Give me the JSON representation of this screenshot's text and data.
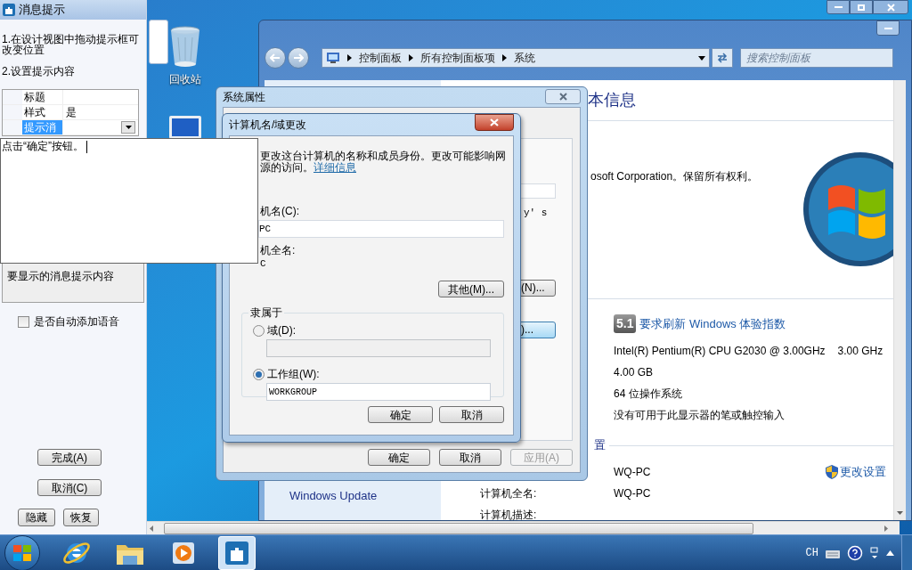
{
  "message_window": {
    "title": "消息提示",
    "steps": [
      "1.在设计视图中拖动提示框可改变位置",
      "2.设置提示内容"
    ],
    "properties": [
      {
        "name": "标题",
        "selected": false
      },
      {
        "name": "样式",
        "value": "是",
        "selected": false
      },
      {
        "name": "提示消",
        "selected": true
      }
    ],
    "editor": {
      "value": "点击“确定”按钮。"
    },
    "description": "要显示的消息提示内容",
    "voice_option": {
      "label": "是否自动添加语音",
      "checked": false
    },
    "buttons": [
      "完成(A)",
      "取消(C)",
      "隐藏",
      "恢复"
    ]
  },
  "desktop": {
    "icons": [
      {
        "kind": "recycle-bin",
        "label": "回收站"
      },
      {
        "kind": "computer"
      }
    ]
  },
  "control_panel": {
    "breadcrumb": [
      "控制面板",
      "所有控制面板项",
      "系统"
    ],
    "search": {
      "placeholder": "搜索控制面板"
    },
    "heading": "本信息",
    "copyright": "osoft Corporation。保留所有权利。",
    "rating": {
      "score": "5.1",
      "link": "要求刷新 Windows 体验指数"
    },
    "specs": [
      {
        "label": "Intel(R) Pentium(R) CPU G2030 @ 3.00GHz",
        "value": "3.00 GHz"
      },
      {
        "label": "4.00 GB"
      },
      {
        "label": "64 位操作系统"
      },
      {
        "label": "没有可用于此显示器的笔或触控输入"
      }
    ],
    "section": "置",
    "computer_name": "WQ-PC",
    "change_link": "更改设置",
    "rows": [
      {
        "label": "计算机全名:",
        "value": "WQ-PC"
      },
      {
        "label": "计算机描述:"
      }
    ],
    "nav": [
      "Windows Update"
    ]
  },
  "system_properties": {
    "title": "系统属性",
    "fragment": "y' s",
    "side_buttons": [
      {
        "label": "(N)...",
        "focused": false
      },
      {
        "label": ")...",
        "focused": true
      }
    ],
    "buttons": [
      {
        "label": "确定",
        "disabled": false
      },
      {
        "label": "取消",
        "disabled": false
      },
      {
        "label": "应用(A)",
        "disabled": true
      }
    ]
  },
  "name_dialog": {
    "title": "计算机名/域更改",
    "intro_lines": [
      "更改这台计算机的名称和成员身份。更改可能影响网",
      "源的访问。"
    ],
    "link": "详细信息",
    "name_label": "机名(C):",
    "name_value": "PC",
    "full_name_label": "机全名:",
    "full_name": "C",
    "more_button": "其他(M)...",
    "member_of": "隶属于",
    "membership": [
      {
        "label": "域(D):",
        "selected": false
      },
      {
        "label": "工作组(W):",
        "selected": true,
        "value": "WORKGROUP"
      }
    ],
    "buttons": [
      "确定",
      "取消"
    ]
  },
  "taskbar": {
    "apps": [
      {
        "kind": "ie",
        "selected": false
      },
      {
        "kind": "explorer",
        "selected": false
      },
      {
        "kind": "media",
        "selected": false
      },
      {
        "kind": "app",
        "selected": true
      }
    ],
    "language": "CH"
  }
}
